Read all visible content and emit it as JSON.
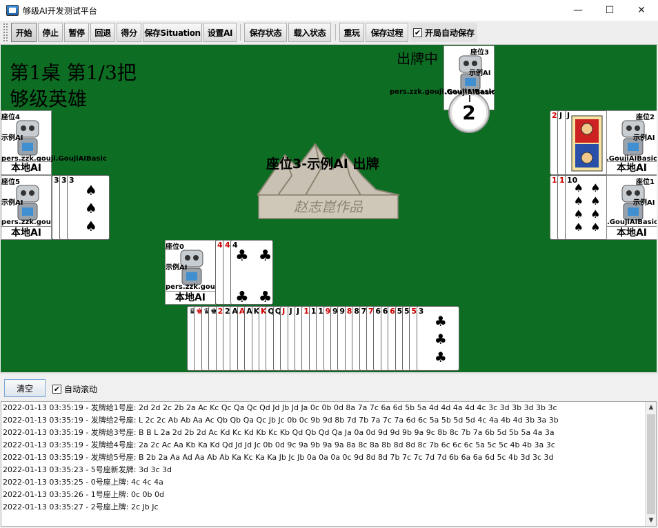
{
  "window": {
    "title": "够级AI开发测试平台",
    "min": "—",
    "max": "☐",
    "close": "✕"
  },
  "toolbar": {
    "start": "开始",
    "stop": "停止",
    "pause": "暂停",
    "undo": "回退",
    "score": "得分",
    "save_situation": "保存Situation",
    "set_ai": "设置AI",
    "save_state": "保存状态",
    "load_state": "载入状态",
    "replay": "重玩",
    "save_process": "保存过程",
    "auto_save_label": "开局自动保存",
    "auto_save_checked": true
  },
  "table": {
    "title_line1": "第1桌  第1/3把",
    "title_line2": "够级英雄",
    "playing_label": "出牌中",
    "center_message": "座位3-示例AI 出牌",
    "timer": "2",
    "logo_text": "赵志崑作品"
  },
  "seats": [
    {
      "id": "seat-0",
      "seat": "座位0",
      "ai": "示例AI",
      "cls": "pers.zzk.gou",
      "type": "本地AI"
    },
    {
      "id": "seat-1",
      "seat": "座位1",
      "ai": "示例AI",
      "cls": ".GoujiAIBasic",
      "type": "本地AI"
    },
    {
      "id": "seat-2",
      "seat": "座位2",
      "ai": "示例AI",
      "cls": ".GoujiAIBasic",
      "type": "本地AI"
    },
    {
      "id": "seat-3",
      "seat": "座位3",
      "ai": "示例AI",
      "cls": "pers.zzk.gouji.GoujiAIBasic",
      "type": ""
    },
    {
      "id": "seat-4",
      "seat": "座位4",
      "ai": "示例AI",
      "cls": "pers.zzk.gouji.GoujiAIBasic",
      "type": "本地AI"
    },
    {
      "id": "seat-5",
      "seat": "座位5",
      "ai": "示例AI",
      "cls": "pers.zzk.gou",
      "type": "本地AI"
    }
  ],
  "played_cards": {
    "seat5": {
      "strip_ranks": [
        "3",
        "3"
      ],
      "top": {
        "rank": "3",
        "suit": "♠"
      }
    },
    "seat0": {
      "strip_ranks": [
        "4",
        "4"
      ],
      "top": {
        "rank": "4",
        "suit": "♣"
      }
    },
    "seat2": {
      "strip_ranks": [
        "2",
        "J"
      ],
      "top": {
        "rank": "J",
        "suit": "♣"
      }
    },
    "seat1": {
      "strip_ranks": [
        "10",
        "10"
      ],
      "top": {
        "rank": "10",
        "suit": "♠"
      }
    }
  },
  "hand": {
    "strip_ranks": [
      "♛",
      "♚",
      "♛",
      "♚",
      "2",
      "2",
      "A",
      "A",
      "A",
      "K",
      "K",
      "Q",
      "Q",
      "J",
      "J",
      "J",
      "10",
      "10",
      "10",
      "9",
      "9",
      "9",
      "8",
      "8",
      "7",
      "7",
      "6",
      "6",
      "6",
      "5",
      "5",
      "5"
    ],
    "top": {
      "rank": "3",
      "suit": "♣"
    }
  },
  "bottom": {
    "clear": "清空",
    "auto_scroll_label": "自动滚动",
    "auto_scroll_checked": true
  },
  "log": [
    "2022-01-13 03:35:19 - 发牌给1号座: 2d 2d 2c 2b 2a Ac Kc Qc Qa Qc Qd Jd Jb Jd Ja 0c 0b 0d 8a 7a 7c 6a 6d 5b 5a 4d 4d 4a 4d 4c 3c 3d 3b 3d 3b 3c",
    "2022-01-13 03:35:19 - 发牌给2号座: L 2c 2c Ab Ab Aa Ac Qb Qb Qa Qc Jb Jc 0b 0c 9b 9d 8b 7d 7b 7a 7c 7a 6d 6c 5a 5b 5d 5d 4c 4a 4b 4d 3b 3a 3b",
    "2022-01-13 03:35:19 - 发牌给3号座: B B L 2a 2d 2b 2d Ac Kd Kc Kd Kb Kc Kb Qd Qb Qd Qa Ja 0a 0d 9d 9d 9b 9a 9c 8b 8c 7b 7a 6b 5d 5b 5a 4a 3a",
    "2022-01-13 03:35:19 - 发牌给4号座: 2a 2c Ac Aa Kb Ka Kd Qd Jd Jd Jc 0b 0d 9c 9a 9b 9a 9a 8a 8c 8a 8b 8d 8d 8c 7b 6c 6c 6c 5a 5c 5c 4b 4b 3a 3c",
    "2022-01-13 03:35:19 - 发牌给5号座: B 2b 2a Aa Ad Aa Ab Ab Ka Kc Ka Ka Jb Jc Jb 0a 0a 0a 0c 9d 8d 8d 7b 7c 7c 7d 7d 6b 6a 6a 6d 5c 4b 3d 3c 3d",
    "2022-01-13 03:35:23 - 5号座新发牌: 3d 3c 3d",
    "2022-01-13 03:35:25 - 0号座上牌: 4c 4c 4a",
    "2022-01-13 03:35:26 - 1号座上牌: 0c 0b 0d",
    "2022-01-13 03:35:27 - 2号座上牌: 2c Jb Jc"
  ]
}
